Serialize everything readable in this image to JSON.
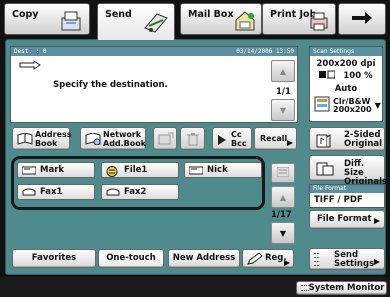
{
  "tabs": [
    {
      "label": "Copy",
      "icon": "copy-icon"
    },
    {
      "label": "Send",
      "icon": "send-icon"
    },
    {
      "label": "Mail Box",
      "icon": "mailbox-icon"
    },
    {
      "label": "Print Job",
      "icon": "print-job-icon"
    }
  ],
  "next_icon": "arrow-right-icon",
  "dest": {
    "label": "Dest. : 0",
    "datetime": "03/14/2006 13:50",
    "message": "Specify the destination.",
    "page": "1/1"
  },
  "scan_settings": {
    "header": "Scan Settings",
    "resolution": "200x200 dpi",
    "zoom": "100 %",
    "density": "Auto",
    "color_mode": "Clr/B&W",
    "color_res": "200x200"
  },
  "controls": {
    "address_book": "Address\nBook",
    "network_address_book": "Network\nAdd.Book",
    "cc_bcc": "Cc\nBcc",
    "recall": "Recall"
  },
  "right_buttons": {
    "two_sided": "2-Sided\nOriginal",
    "diff_size": "Diff. Size\nOriginals",
    "file_format_header": "File Format",
    "file_format_value": "TIFF / PDF",
    "file_format_btn": "File Format",
    "send_settings": "Send\nSettings"
  },
  "onetouch": [
    {
      "label": "Mark",
      "icon": "scanner-icon"
    },
    {
      "label": "File1",
      "icon": "file-server-icon"
    },
    {
      "label": "Nick",
      "icon": "scanner-icon"
    },
    {
      "label": "Fax1",
      "icon": "fax-icon"
    },
    {
      "label": "Fax2",
      "icon": "fax-icon"
    }
  ],
  "onetouch_page": "1/17",
  "bottom": {
    "favorites": "Favorites",
    "one_touch": "One-touch",
    "new_address": "New Address",
    "reg": "Reg."
  },
  "system_monitor": "System Monitor",
  "colors": {
    "panel": "#4f8a8c",
    "header_band": "#5a8fa0"
  }
}
